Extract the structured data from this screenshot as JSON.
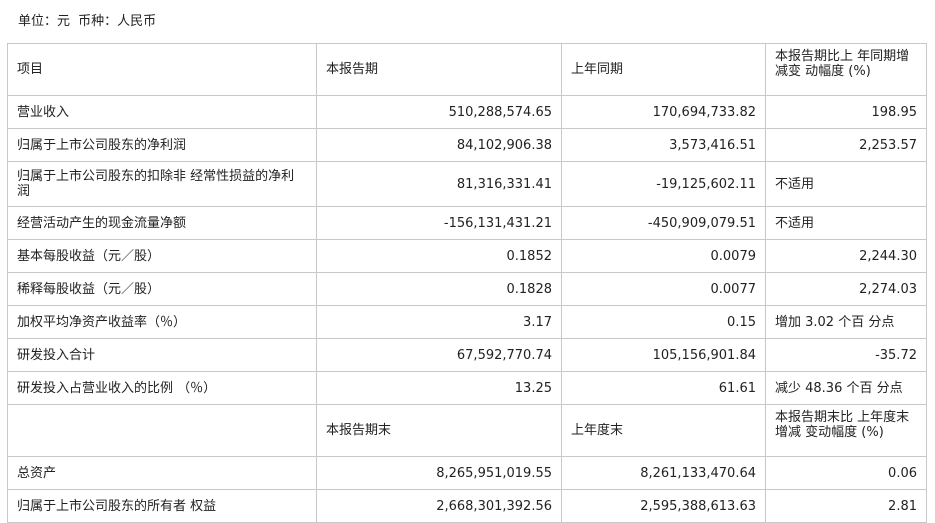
{
  "unit_line": {
    "unit": "单位：元",
    "currency": "币种：人民币"
  },
  "section1": {
    "headers": [
      "项目",
      "本报告期",
      "上年同期",
      "本报告期比上 年同期增减变 动幅度 (%)"
    ],
    "rows": [
      {
        "item": "营业收入",
        "current": "510,288,574.65",
        "prior": "170,694,733.82",
        "change": "198.95"
      },
      {
        "item": "归属于上市公司股东的净利润",
        "current": "84,102,906.38",
        "prior": "3,573,416.51",
        "change": "2,253.57"
      },
      {
        "item": "归属于上市公司股东的扣除非 经常性损益的净利润",
        "current": "81,316,331.41",
        "prior": "-19,125,602.11",
        "change": "不适用"
      },
      {
        "item": "经营活动产生的现金流量净额",
        "current": "-156,131,431.21",
        "prior": "-450,909,079.51",
        "change": "不适用"
      },
      {
        "item": "基本每股收益（元／股）",
        "current": "0.1852",
        "prior": "0.0079",
        "change": "2,244.30"
      },
      {
        "item": "稀释每股收益（元／股）",
        "current": "0.1828",
        "prior": "0.0077",
        "change": "2,274.03"
      },
      {
        "item": "加权平均净资产收益率（％）",
        "current": "3.17",
        "prior": "0.15",
        "change": "增加 3.02 个百 分点"
      },
      {
        "item": "研发投入合计",
        "current": "67,592,770.74",
        "prior": "105,156,901.84",
        "change": "-35.72"
      },
      {
        "item": "研发投入占营业收入的比例 （％）",
        "current": "13.25",
        "prior": "61.61",
        "change": "减少 48.36 个百 分点"
      }
    ]
  },
  "section2": {
    "headers": [
      "",
      "本报告期末",
      "上年度末",
      "本报告期末比 上年度末增减 变动幅度 (%)"
    ],
    "rows": [
      {
        "item": "总资产",
        "current": "8,265,951,019.55",
        "prior": "8,261,133,470.64",
        "change": "0.06"
      },
      {
        "item": "归属于上市公司股东的所有者 权益",
        "current": "2,668,301,392.56",
        "prior": "2,595,388,613.63",
        "change": "2.81"
      }
    ]
  }
}
